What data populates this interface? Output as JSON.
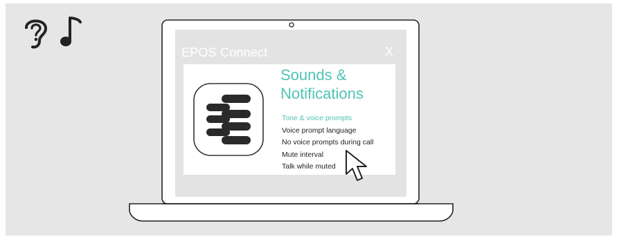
{
  "app": {
    "title": "EPOS Connect",
    "close_label": "X"
  },
  "section": {
    "heading_line1": "Sounds &",
    "heading_line2": "Notifications"
  },
  "menu": {
    "items": [
      {
        "label": "Tone & voice prompts",
        "active": true
      },
      {
        "label": "Voice prompt language",
        "active": false
      },
      {
        "label": "No voice prompts during call",
        "active": false
      },
      {
        "label": "Mute interval",
        "active": false
      },
      {
        "label": "Talk while muted",
        "active": false
      }
    ]
  },
  "icons": {
    "top_left": [
      "ear-help-icon",
      "music-note-icon"
    ],
    "app_logo": "epos-logo-icon",
    "pointer": "mouse-pointer-icon"
  },
  "colors": {
    "accent": "#4fc2b4",
    "panel_bg": "#e6e6e6",
    "screen_bg": "#e3e3e3"
  }
}
